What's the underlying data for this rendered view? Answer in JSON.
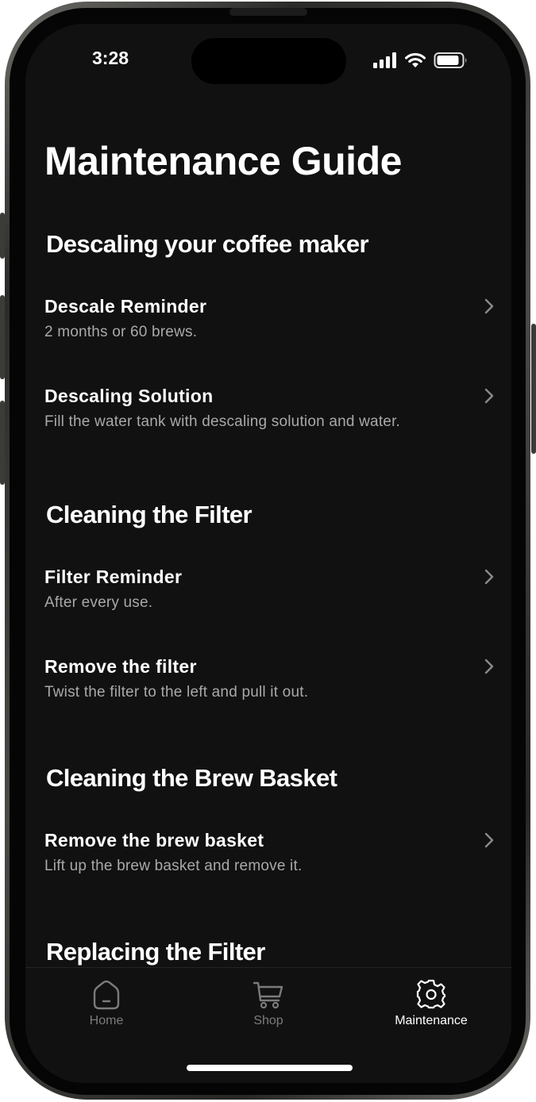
{
  "status_bar": {
    "time": "3:28"
  },
  "page": {
    "title": "Maintenance Guide"
  },
  "sections": [
    {
      "title": "Descaling your coffee maker",
      "items": [
        {
          "title": "Descale Reminder",
          "subtitle": "2 months or 60 brews."
        },
        {
          "title": "Descaling Solution",
          "subtitle": "Fill the water tank with descaling solution and water."
        }
      ]
    },
    {
      "title": "Cleaning the Filter",
      "items": [
        {
          "title": "Filter Reminder",
          "subtitle": "After every use."
        },
        {
          "title": "Remove the filter",
          "subtitle": "Twist the filter to the left and pull it out."
        }
      ]
    },
    {
      "title": "Cleaning the Brew Basket",
      "items": [
        {
          "title": "Remove the brew basket",
          "subtitle": "Lift up the brew basket and remove it."
        }
      ]
    },
    {
      "title": "Replacing the Filter",
      "items": []
    }
  ],
  "tab_bar": {
    "tabs": [
      {
        "label": "Home",
        "icon": "home-icon",
        "active": false
      },
      {
        "label": "Shop",
        "icon": "cart-icon",
        "active": false
      },
      {
        "label": "Maintenance",
        "icon": "gear-icon",
        "active": true
      }
    ]
  },
  "colors": {
    "background": "#111111",
    "text_primary": "#ffffff",
    "text_secondary": "#a9a9a9",
    "tab_inactive": "#7b7b7b"
  }
}
